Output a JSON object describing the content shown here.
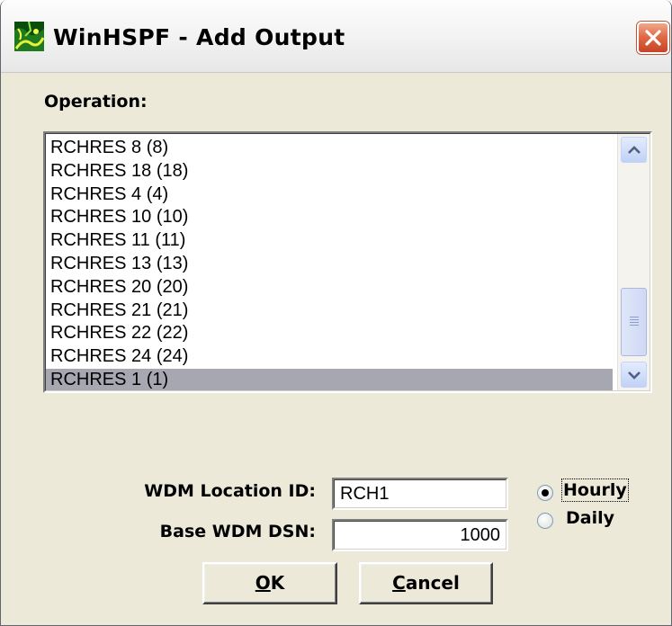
{
  "window": {
    "title": "WinHSPF - Add Output",
    "app_icon": "winhspf-app-icon",
    "close_icon": "close-icon",
    "close_color": "#d9532f"
  },
  "operation": {
    "label": "Operation:",
    "items": [
      "RCHRES 8 (8)",
      "RCHRES 18 (18)",
      "RCHRES 4 (4)",
      "RCHRES 10 (10)",
      "RCHRES 11 (11)",
      "RCHRES 13 (13)",
      "RCHRES 20 (20)",
      "RCHRES 21 (21)",
      "RCHRES 22 (22)",
      "RCHRES 24 (24)",
      "RCHRES 1 (1)"
    ],
    "selected_index": 10,
    "selection_color": "#a6a7b0"
  },
  "wdm_location": {
    "label": "WDM Location ID:",
    "value": "RCH1"
  },
  "base_dsn": {
    "label": "Base WDM DSN:",
    "value": "1000"
  },
  "interval": {
    "hourly_label": "Hourly",
    "daily_label": "Daily",
    "selected": "Hourly"
  },
  "buttons": {
    "ok_mnemonic": "O",
    "ok_rest": "K",
    "cancel_mnemonic": "C",
    "cancel_rest": "ancel"
  }
}
